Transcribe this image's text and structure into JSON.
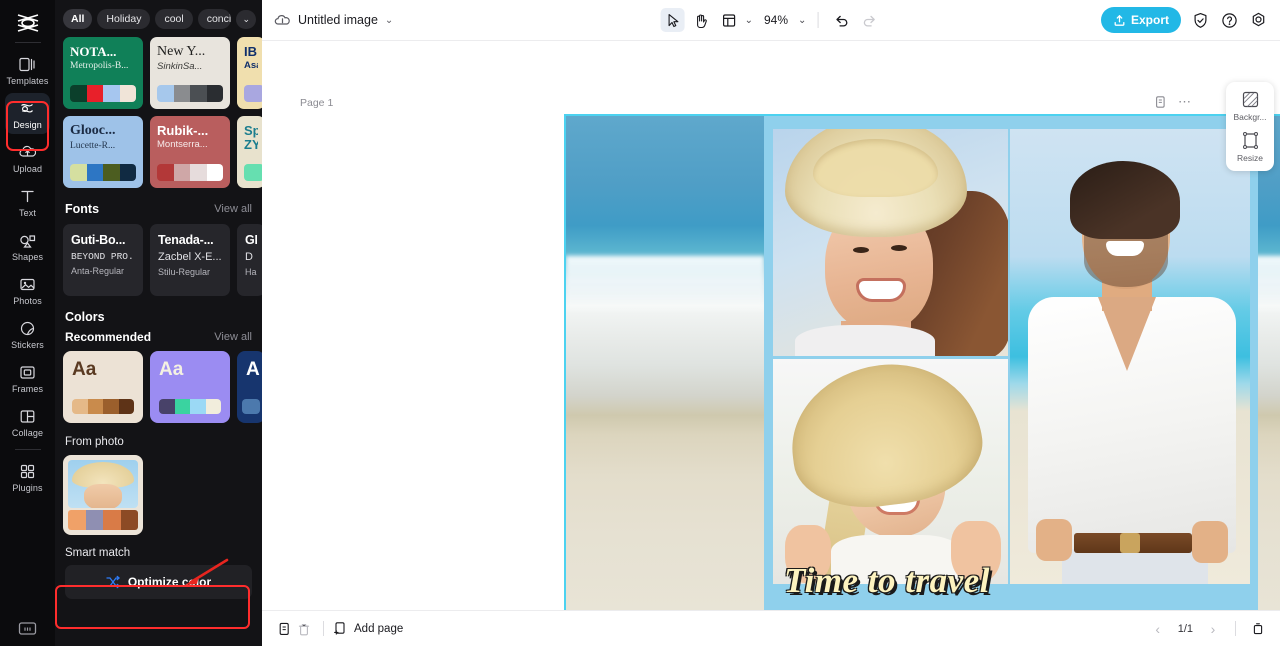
{
  "rail": {
    "logo_icon": "capcut-logo-icon",
    "items": [
      {
        "label": "Templates",
        "icon": "templates-icon"
      },
      {
        "label": "Design",
        "icon": "design-icon",
        "active": true
      },
      {
        "label": "Upload",
        "icon": "upload-cloud-icon"
      },
      {
        "label": "Text",
        "icon": "text-icon"
      },
      {
        "label": "Shapes",
        "icon": "shapes-icon"
      },
      {
        "label": "Photos",
        "icon": "photos-icon"
      },
      {
        "label": "Stickers",
        "icon": "stickers-icon"
      },
      {
        "label": "Frames",
        "icon": "frames-icon"
      },
      {
        "label": "Collage",
        "icon": "collage-icon"
      },
      {
        "label": "Plugins",
        "icon": "plugins-icon"
      }
    ],
    "bottom_icon": "workspace-icon"
  },
  "panel": {
    "chips": [
      {
        "label": "All",
        "selected": true
      },
      {
        "label": "Holiday",
        "selected": false
      },
      {
        "label": "cool",
        "selected": false
      },
      {
        "label": "concise",
        "selected": false
      }
    ],
    "chips_more_icon": "chevron-down-icon",
    "templates": [
      {
        "title": "NOTA...",
        "subtitle": "Metropolis-B...",
        "bg": "#108058",
        "title_color": "#ffffff",
        "sub_color": "#e4efe9",
        "swatches": [
          "#0b3f2b",
          "#e8202a",
          "#a6c6ef",
          "#f0e4d8"
        ]
      },
      {
        "title": "New Y...",
        "subtitle": "SinkinSa...",
        "bg": "#e8e4dd",
        "title_color": "#20201f",
        "sub_color": "#3a3a38",
        "swatches": [
          "#a6c8ec",
          "#8a8c8f",
          "#4b4f53",
          "#2a2d31"
        ]
      },
      {
        "title": "IB",
        "subtitle": "Asa",
        "bg": "#f0dfae",
        "title_color": "#11306b",
        "sub_color": "#11306b",
        "swatches": [
          "#a9a7e0"
        ]
      },
      {
        "title": "Glooc...",
        "subtitle": "Lucette-R...",
        "bg": "#9ec2e8",
        "title_color": "#1b2b44",
        "sub_color": "#24374f",
        "swatches": [
          "#d5dfa0",
          "#2d76c4",
          "#4c5d20",
          "#102a42"
        ]
      },
      {
        "title": "Rubik-...",
        "subtitle": "Montserra...",
        "bg": "#b95e5e",
        "title_color": "#ffffff",
        "sub_color": "#f6e9e9",
        "swatches": [
          "#b33838",
          "#cfa7a7",
          "#e6dcdc",
          "#ffffff"
        ]
      },
      {
        "title": "Sp ZY",
        "subtitle": "",
        "bg": "#e8e2cd",
        "title_color": "#1b7d8e",
        "sub_color": "#1b7d8e",
        "swatches": [
          "#66dfb0"
        ]
      }
    ],
    "fonts_section": {
      "title": "Fonts",
      "view_all": "View all"
    },
    "fonts": [
      {
        "l1": "Guti-Bo...",
        "l2": "BEYOND PRO...",
        "l3": "Anta-Regular"
      },
      {
        "l1": "Tenada-...",
        "l2": "Zacbel X-E...",
        "l3": "Stilu-Regular"
      },
      {
        "l1": "GI",
        "l2": "D",
        "l3": "Ham"
      }
    ],
    "colors_section": {
      "title": "Colors"
    },
    "recommended_section": {
      "title": "Recommended",
      "view_all": "View all"
    },
    "recommended": [
      {
        "sample": "Aa",
        "bg": "#ece2d5",
        "fg": "#5a3a22",
        "swatches": [
          "#e5b988",
          "#c98b4c",
          "#9b5f2c",
          "#5e3317"
        ]
      },
      {
        "sample": "Aa",
        "bg": "#9b8cf2",
        "fg": "#f4f1e2",
        "swatches": [
          "#484269",
          "#3ad3a0",
          "#9bd9f5",
          "#f1eddc"
        ]
      },
      {
        "sample": "A",
        "bg": "#17356e",
        "fg": "#ffffff",
        "swatches": [
          "#4c79ad"
        ]
      }
    ],
    "from_photo_section": {
      "title": "From photo"
    },
    "from_photo_swatches": [
      "#f0a168",
      "#8f8fb2",
      "#d97b47",
      "#8c4a25"
    ],
    "smart_match": {
      "title": "Smart match",
      "button_label": "Optimize color",
      "button_icon": "shuffle-icon"
    },
    "collapse_handle_icon": "chevron-left-icon",
    "arrow_next_icon": "chevron-right-icon"
  },
  "topbar": {
    "cloud_icon": "cloud-sync-icon",
    "doc_title": "Untitled image",
    "title_caret_icon": "chevron-down-icon",
    "tools": [
      {
        "name": "select-tool",
        "icon": "cursor-arrow-icon",
        "selected": true
      },
      {
        "name": "hand-tool",
        "icon": "hand-icon",
        "selected": false
      },
      {
        "name": "layout-tool",
        "icon": "layout-icon",
        "selected": false
      }
    ],
    "layout_caret_icon": "chevron-down-icon",
    "zoom_level": "94%",
    "zoom_caret_icon": "chevron-down-icon",
    "undo_icon": "undo-icon",
    "redo_icon": "redo-icon",
    "export_label": "Export",
    "export_icon": "export-upload-icon",
    "export_color": "#22b8e6",
    "right_icons": [
      {
        "name": "shield-check-icon"
      },
      {
        "name": "help-question-icon"
      },
      {
        "name": "settings-gear-icon"
      }
    ]
  },
  "canvas": {
    "page_label": "Page 1",
    "page_tool_icons": [
      {
        "name": "duplicate-page-icon"
      },
      {
        "name": "more-options-icon"
      }
    ],
    "artboard_border_color": "#4cd2f0",
    "design_title": "Time to travel",
    "design_title_color": "#fdf3bf",
    "background_color": "#8fd0ec"
  },
  "right_panel": {
    "items": [
      {
        "label": "Backgr...",
        "icon": "background-icon"
      },
      {
        "label": "Resize",
        "icon": "resize-icon"
      }
    ]
  },
  "bottombar": {
    "duplicate_icon": "duplicate-icon",
    "delete_icon": "trash-icon",
    "add_page_label": "Add page",
    "add_page_icon": "add-page-icon",
    "prev_icon": "chevron-left-icon",
    "page_indicator": "1/1",
    "next_icon": "chevron-right-icon",
    "pages_panel_icon": "pages-panel-icon"
  },
  "annotations": {
    "highlight_color": "#ff2d2d",
    "arrow_color": "#e8251f"
  }
}
